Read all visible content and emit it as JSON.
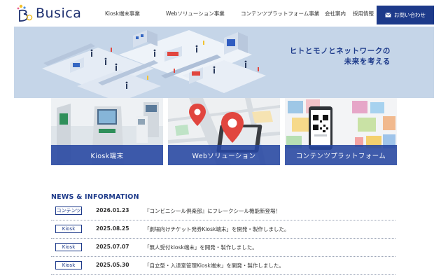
{
  "brand": {
    "name": "Busica"
  },
  "nav": {
    "items": [
      {
        "label": "Kiosk端末事業"
      },
      {
        "label": "Webソリューション事業"
      },
      {
        "label": "コンテンツプラットフォーム事業"
      },
      {
        "label": "会社案内"
      },
      {
        "label": "採用情報"
      }
    ],
    "contact_label": "お問い合わせ"
  },
  "hero": {
    "tagline_line1": "ヒトとモノとネットワークの",
    "tagline_line2": "未来を考える"
  },
  "cards": [
    {
      "label": "Kiosk端末"
    },
    {
      "label": "Webソリューション"
    },
    {
      "label": "コンテンツプラットフォーム"
    }
  ],
  "news": {
    "title": "NEWS & INFORMATION",
    "items": [
      {
        "badge": "コンテンツ",
        "date": "2026.01.23",
        "text": "『コンビニシール倶楽部』にフレークシール機能新登場！"
      },
      {
        "badge": "Kiosk",
        "date": "2025.08.25",
        "text": "「劇場向けチケット発券Kiosk端末」を開発・製作しました。"
      },
      {
        "badge": "Kiosk",
        "date": "2025.07.07",
        "text": "「無人受付kiosk端末」を開発・製作しました。"
      },
      {
        "badge": "Kiosk",
        "date": "2025.05.30",
        "text": "「自立型・入退室管理Kiosk端末」を開発・製作しました。"
      }
    ]
  },
  "colors": {
    "brand_navy": "#1d3a8a",
    "hero_bg": "#c5d5e8",
    "card_overlay": "#2646a0"
  }
}
